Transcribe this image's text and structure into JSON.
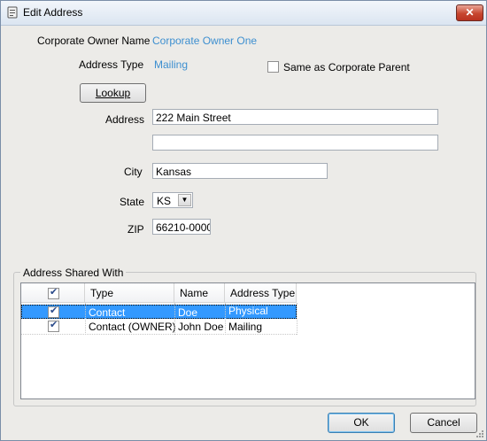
{
  "window": {
    "title": "Edit Address",
    "close_label": "✕"
  },
  "form": {
    "owner_label": "Corporate Owner Name",
    "owner_value": "Corporate Owner One",
    "address_type_label": "Address Type",
    "address_type_value": "Mailing",
    "same_as_parent_label": "Same as Corporate Parent",
    "same_as_parent_checked": false,
    "lookup_label": "Lookup",
    "address_label": "Address",
    "address_line1": "222 Main Street",
    "address_line2": "",
    "city_label": "City",
    "city_value": "Kansas",
    "state_label": "State",
    "state_value": "KS",
    "zip_label": "ZIP",
    "zip_value": "66210-0000"
  },
  "shared": {
    "group_title": "Address Shared With",
    "columns": {
      "type": "Type",
      "name": "Name",
      "address_type": "Address Type"
    },
    "rows": [
      {
        "checked": true,
        "type": "Contact",
        "name": "Doe",
        "address_type": "Physical",
        "selected": true
      },
      {
        "checked": true,
        "type": "Contact (OWNER)",
        "name": "John Doe",
        "address_type": "Mailing",
        "selected": false
      }
    ]
  },
  "footer": {
    "ok_label": "OK",
    "cancel_label": "Cancel"
  },
  "colors": {
    "value_text": "#3d8fd0",
    "selection": "#3399ff",
    "close_button": "#c7462f"
  }
}
